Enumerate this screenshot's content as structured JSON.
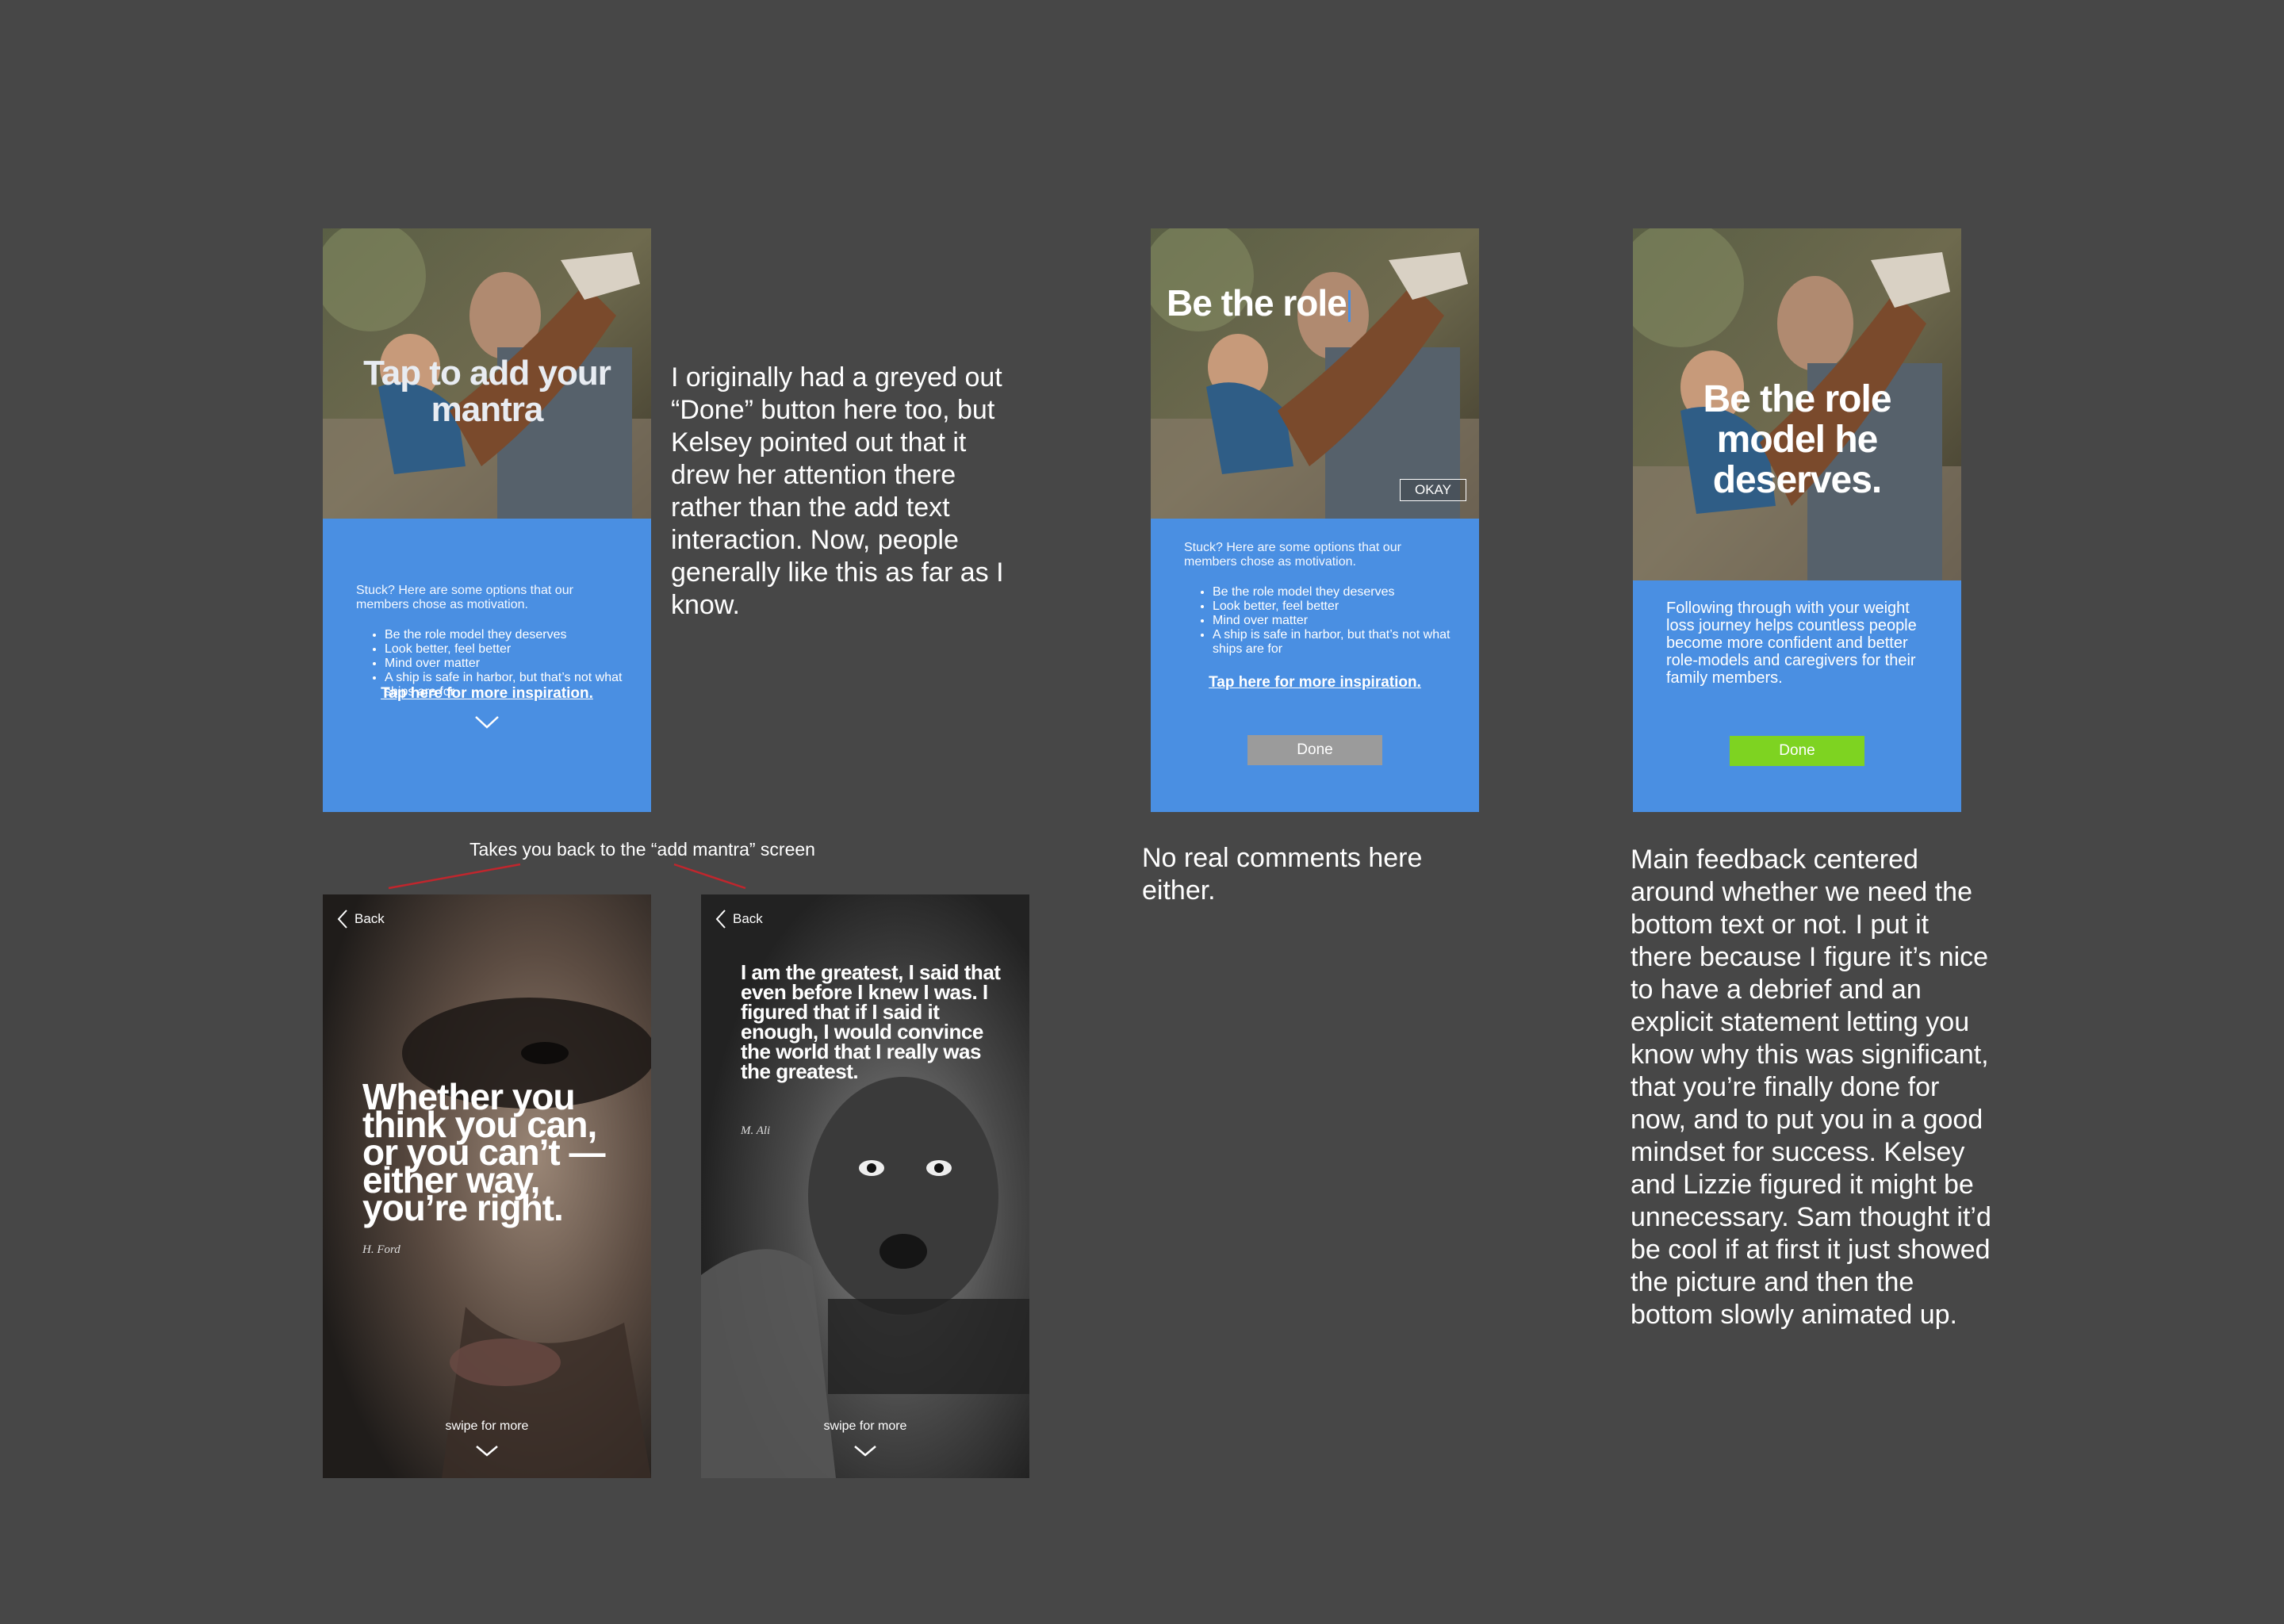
{
  "screen1": {
    "mantra_placeholder": "Tap to add your mantra",
    "stuck_text": "Stuck? Here are some options that our members chose as motivation.",
    "options": [
      "Be the role model they deserves",
      "Look better, feel better",
      "Mind over matter",
      "A ship is safe in harbor, but that’s not what ships are for"
    ],
    "inspiration_link": "Tap here for more inspiration."
  },
  "note1": "I originally had a greyed out “Done” button here too, but Kelsey pointed out that it drew her attention there rather than the add text interaction. Now, people generally like this as far as I know.",
  "back_annotation": "Takes you back to the “add mantra” screen",
  "quote1": {
    "back_label": "Back",
    "quote": "Whether you think you can, or you can’t — either way, you’re right.",
    "author": "H. Ford",
    "swipe": "swipe for more"
  },
  "quote2": {
    "back_label": "Back",
    "quote": "I am the greatest, I said that even before I knew I was. I figured that if I said it enough, I would convince the world that I really was the greatest.",
    "author": "M. Ali",
    "swipe": "swipe for more"
  },
  "screen2": {
    "typed_text": "Be the role",
    "okay_label": "OKAY",
    "stuck_text": "Stuck? Here are some options that our members chose as motivation.",
    "options": [
      "Be the role model they deserves",
      "Look better, feel better",
      "Mind over matter",
      "A ship is safe in harbor, but that’s not what ships are for"
    ],
    "inspiration_link": "Tap here for more inspiration.",
    "done_label": "Done"
  },
  "note2": "No real comments here either.",
  "screen3": {
    "mantra": "Be the role model he deserves.",
    "body": "Following through with your weight loss journey helps countless people become more confident and better role-models and caregivers for their family members.",
    "done_label": "Done"
  },
  "note3": "Main feedback centered around whether we need the bottom text or not. I put it there because I figure it’s nice to have a debrief and an explicit statement letting you know why this was significant, that you’re finally done for now, and to put you in a good mindset for success. Kelsey and Lizzie figured it might be unnecessary. Sam thought it’d be cool if at first it just showed the picture and then the bottom slowly animated up.",
  "colors": {
    "background": "#474747",
    "panel_blue": "#4a8fe2",
    "done_disabled": "#9b9b9b",
    "done_enabled": "#7ed321",
    "annotation_line": "#c0262d"
  }
}
